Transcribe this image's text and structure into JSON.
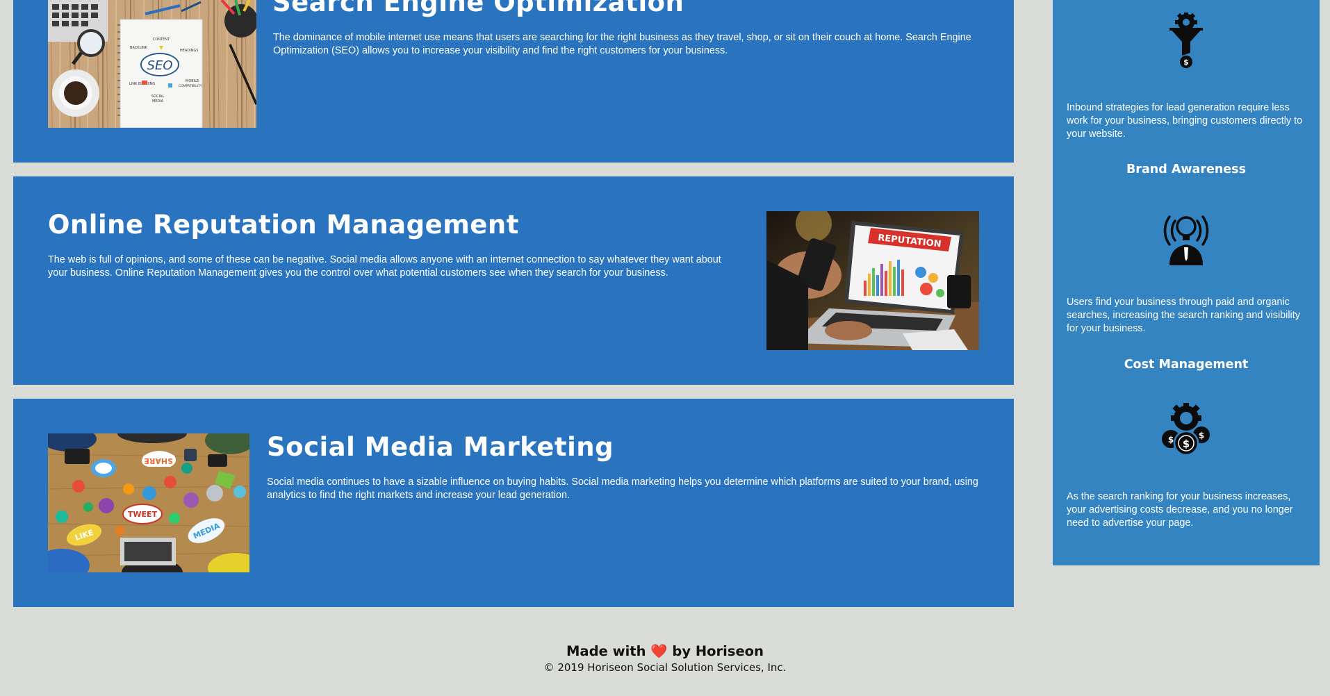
{
  "services": [
    {
      "title": "Search Engine Optimization",
      "body": "The dominance of mobile internet use means that users are searching for the right business as they travel, shop, or sit on their couch at home. Search Engine Optimization (SEO) allows you to increase your visibility and find the right customers for your business.",
      "image_labels": {
        "center": "SEO",
        "content": "CONTENT",
        "backlink": "BACKLINK",
        "headings": "HEADINGS",
        "link_building": "LINK BUILDING",
        "mobile": "MOBILE",
        "compatibility": "COMPATIBILITY",
        "social": "SOCIAL",
        "media": "MEDIA"
      }
    },
    {
      "title": "Online Reputation Management",
      "body": "The web is full of opinions, and some of these can be negative. Social media allows anyone with an internet connection to say whatever they want about your business. Online Reputation Management gives you the control over what potential customers see when they search for your business.",
      "image_labels": {
        "banner": "REPUTATION"
      }
    },
    {
      "title": "Social Media Marketing",
      "body": "Social media continues to have a sizable influence on buying habits. Social media marketing helps you determine which platforms are suited to your brand, using analytics to find the right markets and increase your lead generation.",
      "image_labels": {
        "share": "SHARE",
        "tweet": "TWEET",
        "like": "LIKE",
        "media": "MEDIA"
      }
    }
  ],
  "sidebar": {
    "items": [
      {
        "title": "",
        "icon": "lead-generation-funnel-icon",
        "body": "Inbound strategies for lead generation require less work for your business, bringing customers directly to your website."
      },
      {
        "title": "Brand Awareness",
        "icon": "brand-awareness-lightbulb-icon",
        "body": "Users find your business through paid and organic searches, increasing the search ranking and visibility for your business."
      },
      {
        "title": "Cost Management",
        "icon": "cost-management-coins-icon",
        "body": "As the search ranking for your business increases, your advertising costs decrease, and you no longer need to advertise your page."
      }
    ]
  },
  "footer": {
    "made_with_prefix": "Made with",
    "heart": "❤️",
    "made_with_suffix": "by Horiseon",
    "copyright": "© 2019 Horiseon Social Solution Services, Inc."
  },
  "colors": {
    "page_background": "#d9dcd6",
    "card_background": "#2a74bf",
    "sidebar_background": "#3484c2",
    "text_light": "#ffffff",
    "footer_text": "#111111",
    "heart": "#e0242b"
  }
}
